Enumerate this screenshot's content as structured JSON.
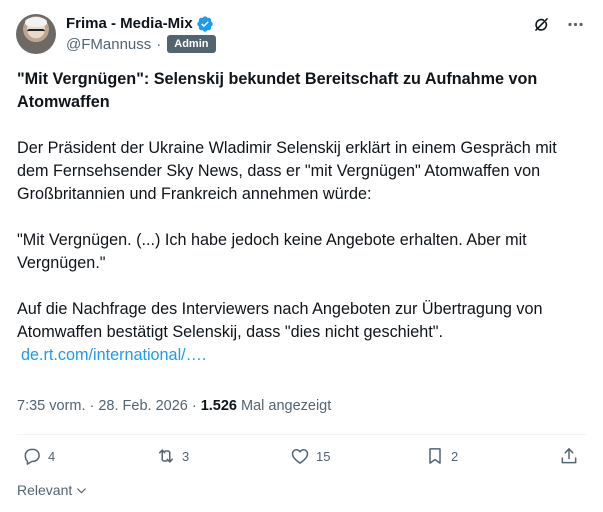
{
  "author": {
    "display_name": "Frima - Media-Mix",
    "handle": "@FMannuss",
    "separator": "·",
    "badge": "Admin"
  },
  "post": {
    "headline": "\"Mit Vergnügen\": Selenskij bekundet Bereitschaft zu Aufnahme von Atomwaffen",
    "paragraph1": "Der Präsident der Ukraine Wladimir Selenskij erklärt in einem Gespräch mit dem Fernsehsender Sky News, dass er \"mit Vergnügen\" Atomwaffen von Großbritannien und Frankreich annehmen würde:",
    "paragraph2": "\"Mit Vergnügen. (...) Ich habe jedoch keine Angebote erhalten. Aber mit Vergnügen.\"",
    "paragraph3": "Auf die Nachfrage des Interviewers nach Angeboten zur Übertragung von Atomwaffen bestätigt Selenskij, dass \"dies nicht geschieht\".",
    "link_text": "de.rt.com/international/…."
  },
  "meta": {
    "time": "7:35 vorm.",
    "dot": "·",
    "date": "28. Feb. 2026",
    "dot2": "·",
    "views_count": "1.526",
    "views_label": "Mal angezeigt"
  },
  "actions": {
    "replies": "4",
    "reposts": "3",
    "likes": "15",
    "bookmarks": "2"
  },
  "sort": {
    "label": "Relevant"
  },
  "icons": {
    "verified": "verified-badge-icon",
    "grok": "grok-icon",
    "more": "more-icon",
    "reply": "reply-icon",
    "repost": "repost-icon",
    "like": "heart-icon",
    "bookmark": "bookmark-icon",
    "share": "share-icon",
    "chevron": "chevron-down-icon"
  },
  "colors": {
    "accent": "#1d9bf0",
    "secondary_text": "#536471",
    "primary_text": "#0f1419"
  }
}
